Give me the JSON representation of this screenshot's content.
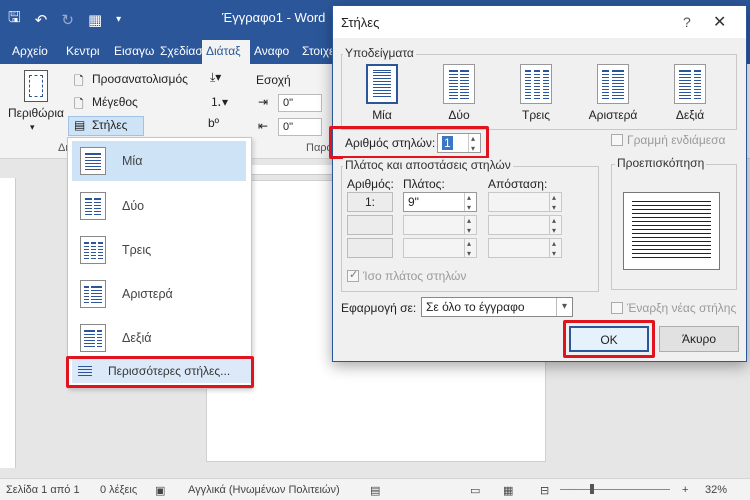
{
  "window": {
    "doc_title": "Έγγραφο1 - Word",
    "tabs": [
      "Αρχείο",
      "Κεντρι",
      "Εισαγω",
      "Σχεδίασ",
      "Διάταξ",
      "Αναφο",
      "Στοιχε"
    ]
  },
  "ribbon": {
    "margins_label": "Περιθώρια",
    "orientation_label": "Προσανατολισμός",
    "size_label": "Μέγεθος",
    "columns_label": "Στήλες",
    "breaks_icon_label": "bº",
    "indent_label": "Εσοχή",
    "indent_left_value": "0\"",
    "indent_right_value": "0\"",
    "group_page_setup": "Δι",
    "group_paragraph": "Παρά"
  },
  "columns_menu": {
    "items": [
      "Μία",
      "Δύο",
      "Τρεις",
      "Αριστερά",
      "Δεξιά"
    ],
    "more": "Περισσότερες στήλες..."
  },
  "dialog": {
    "title": "Στήλες",
    "help": "?",
    "close": "✕",
    "presets_label": "Υποδείγματα",
    "presets": [
      "Μία",
      "Δύο",
      "Τρεις",
      "Αριστερά",
      "Δεξιά"
    ],
    "num_columns_label": "Αριθμός στηλών:",
    "num_columns_value": "1",
    "line_between_label": "Γραμμή ενδιάμεσα",
    "width_spacing_label": "Πλάτος και αποστάσεις στηλών",
    "col_number_header": "Αριθμός:",
    "width_header": "Πλάτος:",
    "spacing_header": "Απόσταση:",
    "row1_number": "1:",
    "row1_width": "9\"",
    "equal_width_label": "Ίσο πλάτος στηλών",
    "preview_label": "Προεπισκόπηση",
    "apply_to_label": "Εφαρμογή σε:",
    "apply_to_value": "Σε όλο το έγγραφο",
    "new_column_label": "Έναρξη νέας στήλης",
    "ok": "OK",
    "cancel": "Άκυρο"
  },
  "status": {
    "page": "Σελίδα 1 από 1",
    "words": "0 λέξεις",
    "language": "Αγγλικά (Ηνωμένων Πολιτειών)",
    "zoom": "32%"
  },
  "colors": {
    "accent": "#2b579a",
    "highlight": "#e0141e"
  }
}
